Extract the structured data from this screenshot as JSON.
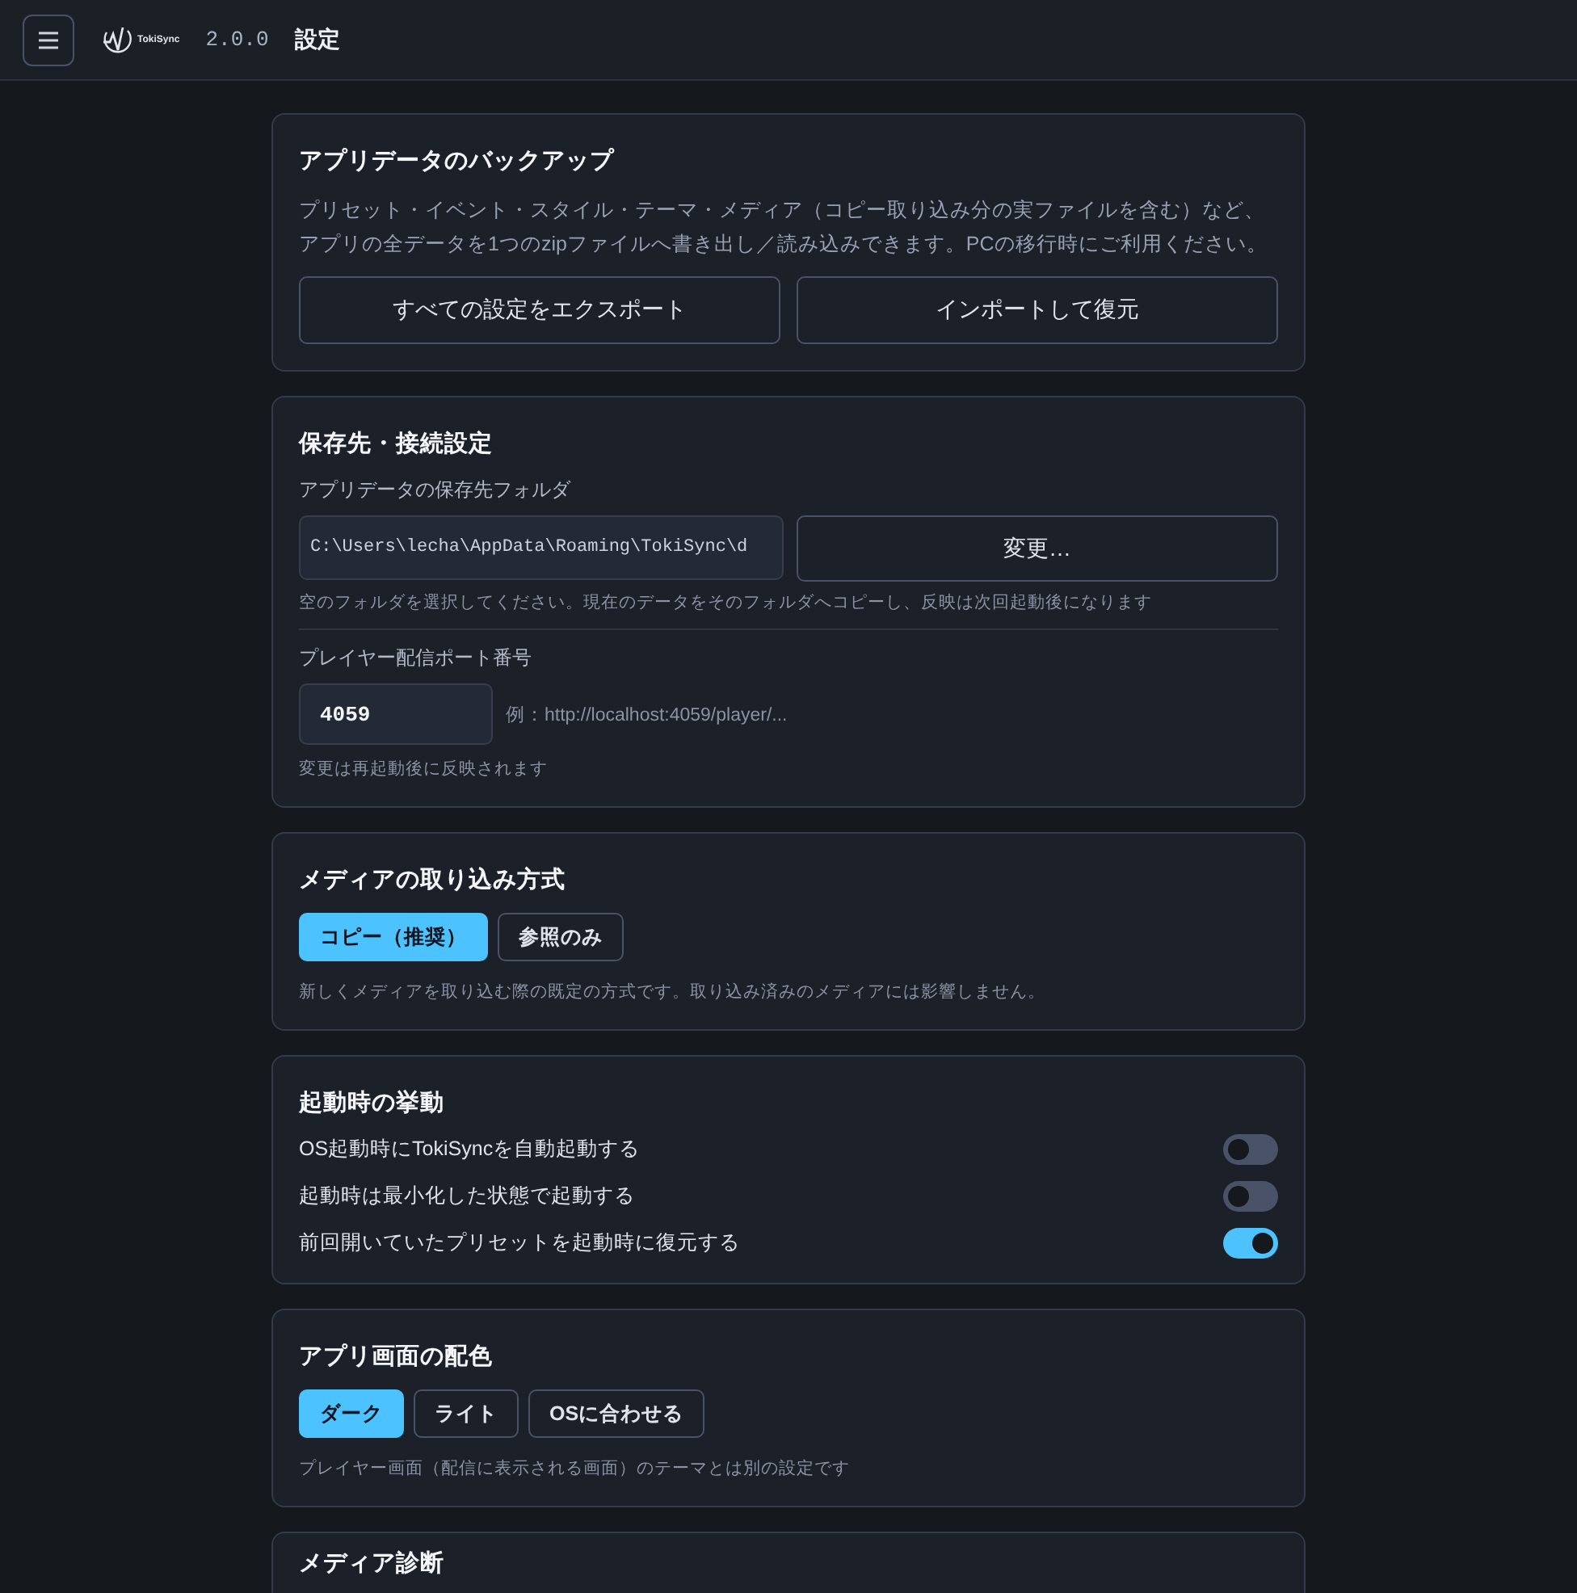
{
  "header": {
    "logo_text": "TokiSync",
    "version": "2.0.0",
    "title": "設定"
  },
  "sections": [
    {
      "kind": "backup",
      "title": "アプリデータのバックアップ",
      "description": "プリセット・イベント・スタイル・テーマ・メディア（コピー取り込み分の実ファイルを含む）など、アプリの全データを1つのzipファイルへ書き出し／読み込みできます。PCの移行時にご利用ください。",
      "buttons": [
        "すべての設定をエクスポート",
        "インポートして復元"
      ]
    },
    {
      "kind": "storage",
      "title": "保存先・接続設定",
      "folder_label": "アプリデータの保存先フォルダ",
      "folder_path": "C:\\Users\\lecha\\AppData\\Roaming\\TokiSync\\d",
      "change_button": "変更…",
      "folder_hint": "空のフォルダを選択してください。現在のデータをそのフォルダへコピーし、反映は次回起動後になります",
      "port_label": "プレイヤー配信ポート番号",
      "port_value": "4059",
      "port_example": "例：http://localhost:4059/player/...",
      "port_hint": "変更は再起動後に反映されます"
    },
    {
      "kind": "choice",
      "title": "メディアの取り込み方式",
      "options": [
        {
          "label": "コピー（推奨）",
          "selected": true
        },
        {
          "label": "参照のみ",
          "selected": false
        }
      ],
      "hint": "新しくメディアを取り込む際の既定の方式です。取り込み済みのメディアには影響しません。"
    },
    {
      "kind": "toggles",
      "title": "起動時の挙動",
      "items": [
        {
          "label": "OS起動時にTokiSyncを自動起動する",
          "on": false
        },
        {
          "label": "起動時は最小化した状態で起動する",
          "on": false
        },
        {
          "label": "前回開いていたプリセットを起動時に復元する",
          "on": true
        }
      ]
    },
    {
      "kind": "choice",
      "title": "アプリ画面の配色",
      "options": [
        {
          "label": "ダーク",
          "selected": true
        },
        {
          "label": "ライト",
          "selected": false
        },
        {
          "label": "OSに合わせる",
          "selected": false
        }
      ],
      "hint": "プレイヤー画面（配信に表示される画面）のテーマとは別の設定です"
    },
    {
      "kind": "heading",
      "title": "メディア診断"
    }
  ]
}
